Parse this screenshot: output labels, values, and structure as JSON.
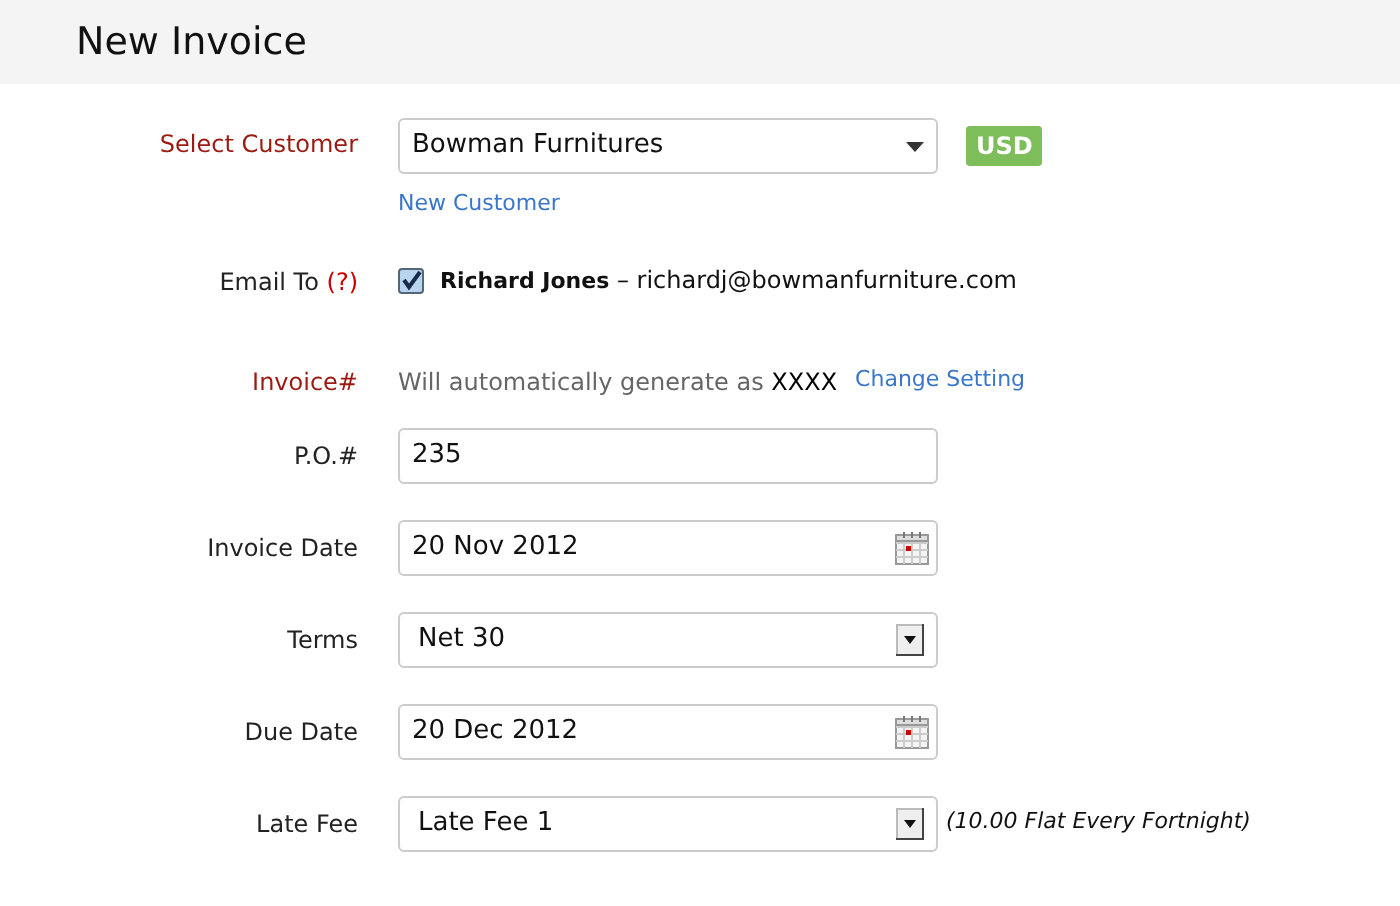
{
  "title": "New Invoice",
  "customer": {
    "label": "Select Customer",
    "required": true,
    "value": "Bowman Furnitures",
    "currency": "USD",
    "link": "New Customer"
  },
  "email": {
    "label": "Email To",
    "help": "(?)",
    "checked": true,
    "name": "Richard Jones",
    "address": " – richardj@bowmanfurniture.com"
  },
  "invoice_number": {
    "label": "Invoice#",
    "required": true,
    "text": "Will automatically generate as",
    "value": "XXXX",
    "link": "Change Setting"
  },
  "fields": [
    {
      "kind": "text",
      "label": "P.O.#",
      "required": false,
      "value": "235"
    },
    {
      "kind": "date",
      "label": "Invoice Date",
      "required": false,
      "value": "20 Nov 2012"
    },
    {
      "kind": "select",
      "label": "Terms",
      "required": false,
      "value": "Net 30"
    },
    {
      "kind": "date",
      "label": "Due Date",
      "required": false,
      "value": "20 Dec 2012"
    },
    {
      "kind": "select",
      "label": "Late Fee",
      "required": false,
      "value": "Late Fee 1",
      "note": "(10.00 Flat Every Fortnight)"
    }
  ]
}
